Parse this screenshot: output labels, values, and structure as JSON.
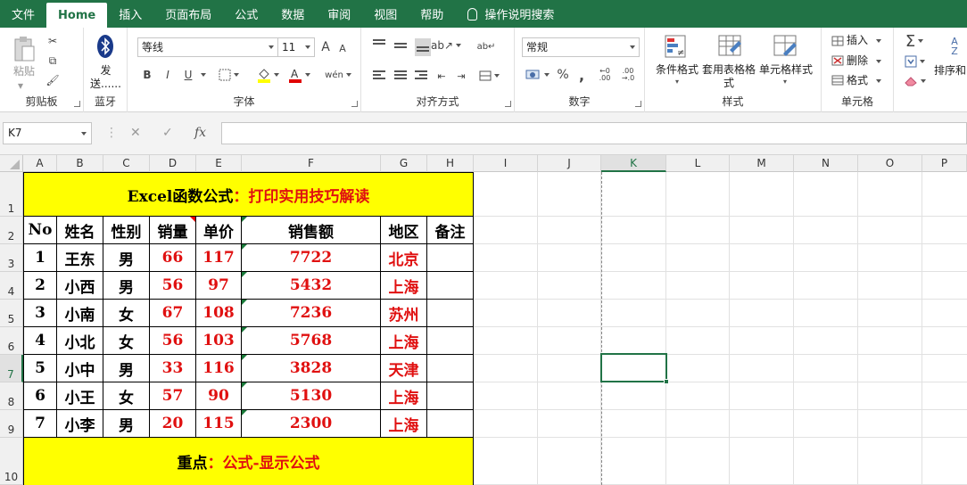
{
  "tabs": [
    "文件",
    "Home",
    "插入",
    "页面布局",
    "公式",
    "数据",
    "审阅",
    "视图",
    "帮助"
  ],
  "tell_me": "操作说明搜索",
  "ribbon": {
    "clipboard": {
      "paste": "粘贴",
      "label": "剪贴板"
    },
    "bluetooth": {
      "send": "发送......",
      "label": "蓝牙"
    },
    "font": {
      "name": "等线",
      "size": "11",
      "grow": "A",
      "shrink": "A",
      "bold": "B",
      "italic": "I",
      "underline": "U",
      "phonetic": "wén",
      "label": "字体"
    },
    "align": {
      "label": "对齐方式"
    },
    "number": {
      "format": "常规",
      "percent": "%",
      "comma": ",",
      "label": "数字"
    },
    "styles": {
      "cond": "条件格式",
      "table": "套用表格格式",
      "cell": "单元格样式",
      "label": "样式"
    },
    "cells": {
      "insert": "插入",
      "delete": "删除",
      "format": "格式",
      "label": "单元格"
    },
    "editing": {
      "sort": "排序和"
    }
  },
  "formula_bar": {
    "name_box": "K7",
    "fx": "fx",
    "formula": ""
  },
  "columns": [
    "A",
    "B",
    "C",
    "D",
    "E",
    "F",
    "G",
    "H",
    "I",
    "J",
    "K",
    "L",
    "M",
    "N",
    "O",
    "P"
  ],
  "rows": [
    "1",
    "2",
    "3",
    "4",
    "5",
    "6",
    "7",
    "8",
    "9",
    "10"
  ],
  "selected_cell": "K7",
  "sheet": {
    "title_black": "Excel函数公式",
    "title_red": "：打印实用技巧解读",
    "headers": [
      "No",
      "姓名",
      "性别",
      "销量",
      "单价",
      "销售额",
      "地区",
      "备注"
    ],
    "data": [
      [
        "1",
        "王东",
        "男",
        "66",
        "117",
        "7722",
        "北京",
        ""
      ],
      [
        "2",
        "小西",
        "男",
        "56",
        "97",
        "5432",
        "上海",
        ""
      ],
      [
        "3",
        "小南",
        "女",
        "67",
        "108",
        "7236",
        "苏州",
        ""
      ],
      [
        "4",
        "小北",
        "女",
        "56",
        "103",
        "5768",
        "上海",
        ""
      ],
      [
        "5",
        "小中",
        "男",
        "33",
        "116",
        "3828",
        "天津",
        ""
      ],
      [
        "6",
        "小王",
        "女",
        "57",
        "90",
        "5130",
        "上海",
        ""
      ],
      [
        "7",
        "小李",
        "男",
        "20",
        "115",
        "2300",
        "上海",
        ""
      ]
    ],
    "footer_black": "重点",
    "footer_red": "：公式-显示公式"
  },
  "colors": {
    "ribbon": "#217346",
    "highlight": "#ffff00",
    "red_text": "#e01010"
  }
}
